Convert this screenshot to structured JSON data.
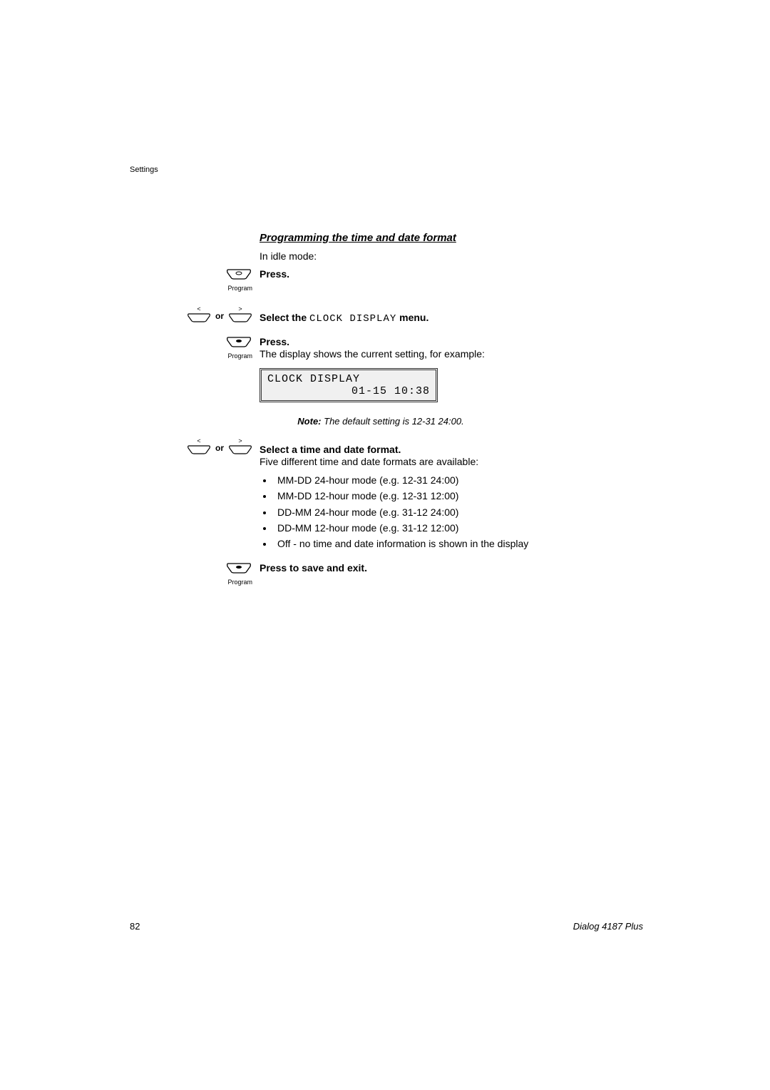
{
  "header": {
    "pageLabel": "Settings"
  },
  "section": {
    "title": "Programming the time and date format",
    "intro": "In idle mode:"
  },
  "steps": {
    "step1": {
      "buttonLabel": "Program",
      "action": "Press."
    },
    "step2": {
      "separator": "or",
      "actionPrefix": "Select the ",
      "menuName": "CLOCK DISPLAY",
      "actionSuffix": " menu."
    },
    "step3": {
      "buttonLabel": "Program",
      "action": "Press.",
      "description": "The display shows the current setting, for example:"
    },
    "display": {
      "line1": "CLOCK DISPLAY",
      "line2": "01-15 10:38"
    },
    "note": {
      "label": "Note:",
      "text": " The default setting is 12-31 24:00."
    },
    "step4": {
      "separator": "or",
      "action": "Select a time and date format.",
      "description": "Five different time and date formats are available:"
    },
    "formats": [
      "MM-DD 24-hour mode (e.g. 12-31 24:00)",
      "MM-DD 12-hour mode (e.g. 12-31 12:00)",
      "DD-MM 24-hour mode (e.g. 31-12 24:00)",
      "DD-MM 12-hour mode (e.g. 31-12 12:00)",
      "Off - no time and date information is shown in the display"
    ],
    "step5": {
      "buttonLabel": "Program",
      "action": "Press to save and exit."
    }
  },
  "footer": {
    "pageNumber": "82",
    "productName": "Dialog 4187 Plus"
  },
  "symbols": {
    "lt": "<",
    "gt": ">"
  }
}
